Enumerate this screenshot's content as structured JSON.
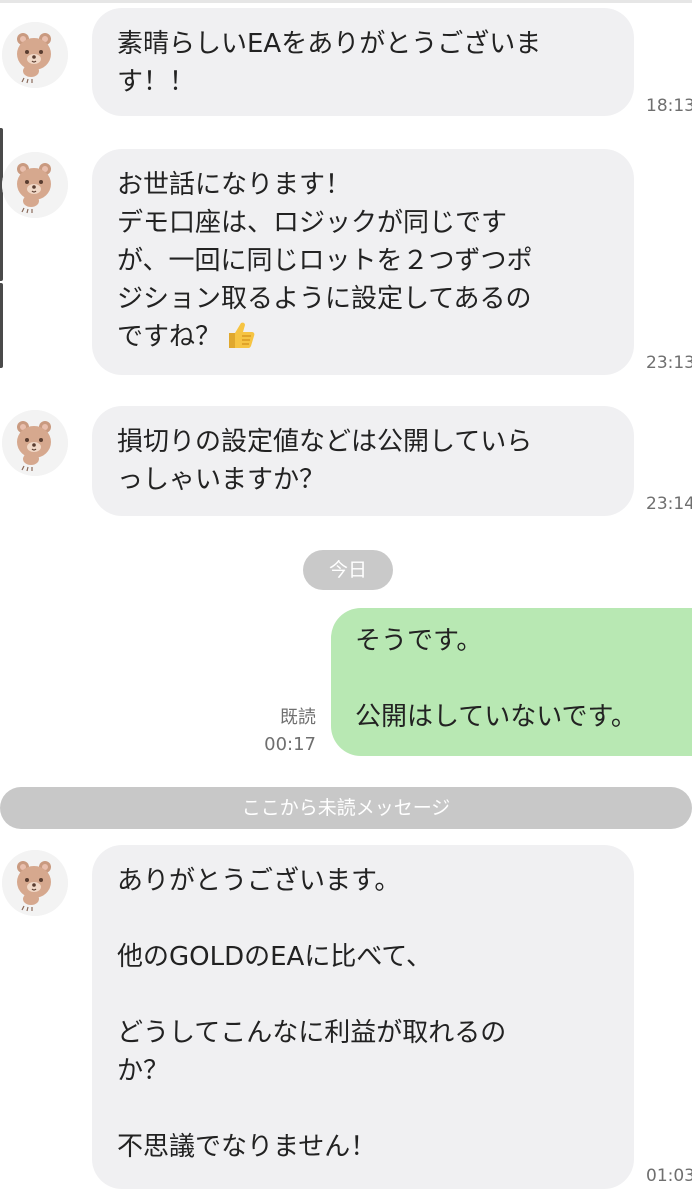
{
  "chat": {
    "messages": [
      {
        "text": "素晴らしいEAをありがとうございま\nす！！",
        "time": "18:13"
      },
      {
        "text": "お世話になります！\nデモ口座は、ロジックが同じです\nが、一回に同じロットを２つずつポ\nジション取るように設定してあるの\nですね？",
        "emoji": "👍",
        "time": "23:13"
      },
      {
        "text": "損切りの設定値などは公開していら\nっしゃいますか？",
        "time": "23:14"
      }
    ],
    "date_separator": "今日",
    "own_message": {
      "text": "そうです。\n\n公開はしていないです。",
      "read_label": "既読",
      "time": "00:17"
    },
    "unread_separator": "ここから未読メッセージ",
    "last_message": {
      "text": "ありがとうございます。\n\n他のGOLDのEAに比べて、\n\nどうしてこんなに利益が取れるの\nか？\n\n不思議でなりません！",
      "time": "01:03"
    },
    "avatar_icon": "bear-avatar-icon",
    "colors": {
      "incoming_bubble": "#f0f0f2",
      "outgoing_bubble": "#b8e8b3",
      "separator": "#c8c8c8"
    }
  }
}
